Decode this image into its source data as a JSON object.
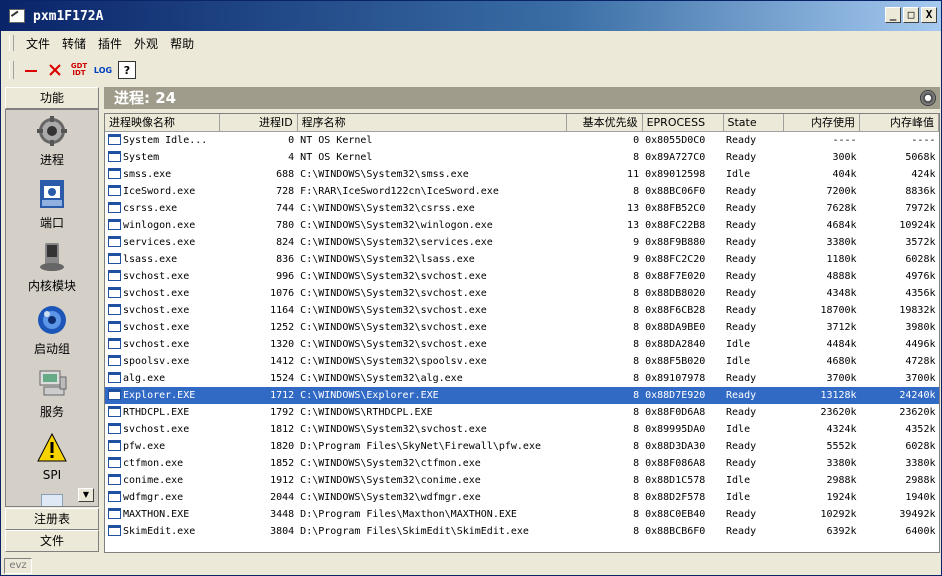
{
  "window": {
    "title": "pxm1F172A",
    "min": "_",
    "max": "□",
    "close": "X"
  },
  "menu": [
    "文件",
    "转储",
    "插件",
    "外观",
    "帮助"
  ],
  "toolbar": {
    "gdt": "GDT\nIDT",
    "log": "LOG",
    "help": "?"
  },
  "left": {
    "header": "功能",
    "items": [
      {
        "label": "进程",
        "icon": "gear-icon"
      },
      {
        "label": "端口",
        "icon": "network-icon"
      },
      {
        "label": "内核模块",
        "icon": "disk-icon"
      },
      {
        "label": "启动组",
        "icon": "globe-icon"
      },
      {
        "label": "服务",
        "icon": "computer-icon"
      },
      {
        "label": "SPI",
        "icon": "warning-icon"
      }
    ],
    "footers": [
      "注册表",
      "文件"
    ]
  },
  "right": {
    "header_label": "进程:",
    "header_count": "24",
    "columns": [
      "进程映像名称",
      "进程ID",
      "程序名称",
      "基本优先级",
      "EPROCESS",
      "State",
      "内存使用",
      "内存峰值"
    ],
    "rows": [
      [
        "System Idle...",
        "0",
        "NT OS Kernel",
        "0",
        "0x8055D0C0",
        "Ready",
        "----",
        "----"
      ],
      [
        "System",
        "4",
        "NT OS Kernel",
        "8",
        "0x89A727C0",
        "Ready",
        "300k",
        "5068k"
      ],
      [
        "smss.exe",
        "688",
        "C:\\WINDOWS\\System32\\smss.exe",
        "11",
        "0x89012598",
        "Idle",
        "404k",
        "424k"
      ],
      [
        "IceSword.exe",
        "728",
        "F:\\RAR\\IceSword122cn\\IceSword.exe",
        "8",
        "0x88BC06F0",
        "Ready",
        "7200k",
        "8836k"
      ],
      [
        "csrss.exe",
        "744",
        "C:\\WINDOWS\\System32\\csrss.exe",
        "13",
        "0x88FB52C0",
        "Ready",
        "7628k",
        "7972k"
      ],
      [
        "winlogon.exe",
        "780",
        "C:\\WINDOWS\\System32\\winlogon.exe",
        "13",
        "0x88FC22B8",
        "Ready",
        "4684k",
        "10924k"
      ],
      [
        "services.exe",
        "824",
        "C:\\WINDOWS\\System32\\services.exe",
        "9",
        "0x88F9B880",
        "Ready",
        "3380k",
        "3572k"
      ],
      [
        "lsass.exe",
        "836",
        "C:\\WINDOWS\\System32\\lsass.exe",
        "9",
        "0x88FC2C20",
        "Ready",
        "1180k",
        "6028k"
      ],
      [
        "svchost.exe",
        "996",
        "C:\\WINDOWS\\System32\\svchost.exe",
        "8",
        "0x88F7E020",
        "Ready",
        "4888k",
        "4976k"
      ],
      [
        "svchost.exe",
        "1076",
        "C:\\WINDOWS\\System32\\svchost.exe",
        "8",
        "0x88DB8020",
        "Ready",
        "4348k",
        "4356k"
      ],
      [
        "svchost.exe",
        "1164",
        "C:\\WINDOWS\\System32\\svchost.exe",
        "8",
        "0x88F6CB28",
        "Ready",
        "18700k",
        "19832k"
      ],
      [
        "svchost.exe",
        "1252",
        "C:\\WINDOWS\\System32\\svchost.exe",
        "8",
        "0x88DA9BE0",
        "Ready",
        "3712k",
        "3980k"
      ],
      [
        "svchost.exe",
        "1320",
        "C:\\WINDOWS\\System32\\svchost.exe",
        "8",
        "0x88DA2840",
        "Idle",
        "4484k",
        "4496k"
      ],
      [
        "spoolsv.exe",
        "1412",
        "C:\\WINDOWS\\System32\\spoolsv.exe",
        "8",
        "0x88F5B020",
        "Idle",
        "4680k",
        "4728k"
      ],
      [
        "alg.exe",
        "1524",
        "C:\\WINDOWS\\System32\\alg.exe",
        "8",
        "0x89107978",
        "Ready",
        "3700k",
        "3700k"
      ],
      [
        "Explorer.EXE",
        "1712",
        "C:\\WINDOWS\\Explorer.EXE",
        "8",
        "0x88D7E920",
        "Ready",
        "13128k",
        "24240k"
      ],
      [
        "RTHDCPL.EXE",
        "1792",
        "C:\\WINDOWS\\RTHDCPL.EXE",
        "8",
        "0x88F0D6A8",
        "Ready",
        "23620k",
        "23620k"
      ],
      [
        "svchost.exe",
        "1812",
        "C:\\WINDOWS\\System32\\svchost.exe",
        "8",
        "0x89995DA0",
        "Idle",
        "4324k",
        "4352k"
      ],
      [
        "pfw.exe",
        "1820",
        "D:\\Program Files\\SkyNet\\Firewall\\pfw.exe",
        "8",
        "0x88D3DA30",
        "Ready",
        "5552k",
        "6028k"
      ],
      [
        "ctfmon.exe",
        "1852",
        "C:\\WINDOWS\\System32\\ctfmon.exe",
        "8",
        "0x88F086A8",
        "Ready",
        "3380k",
        "3380k"
      ],
      [
        "conime.exe",
        "1912",
        "C:\\WINDOWS\\System32\\conime.exe",
        "8",
        "0x88D1C578",
        "Idle",
        "2988k",
        "2988k"
      ],
      [
        "wdfmgr.exe",
        "2044",
        "C:\\WINDOWS\\System32\\wdfmgr.exe",
        "8",
        "0x88D2F578",
        "Idle",
        "1924k",
        "1940k"
      ],
      [
        "MAXTHON.EXE",
        "3448",
        "D:\\Program Files\\Maxthon\\MAXTHON.EXE",
        "8",
        "0x88C0EB40",
        "Ready",
        "10292k",
        "39492k"
      ],
      [
        "SkimEdit.exe",
        "3804",
        "D:\\Program Files\\SkimEdit\\SkimEdit.exe",
        "8",
        "0x88BCB6F0",
        "Ready",
        "6392k",
        "6400k"
      ]
    ],
    "selected_row": 15
  },
  "status": {
    "text": "evz"
  }
}
